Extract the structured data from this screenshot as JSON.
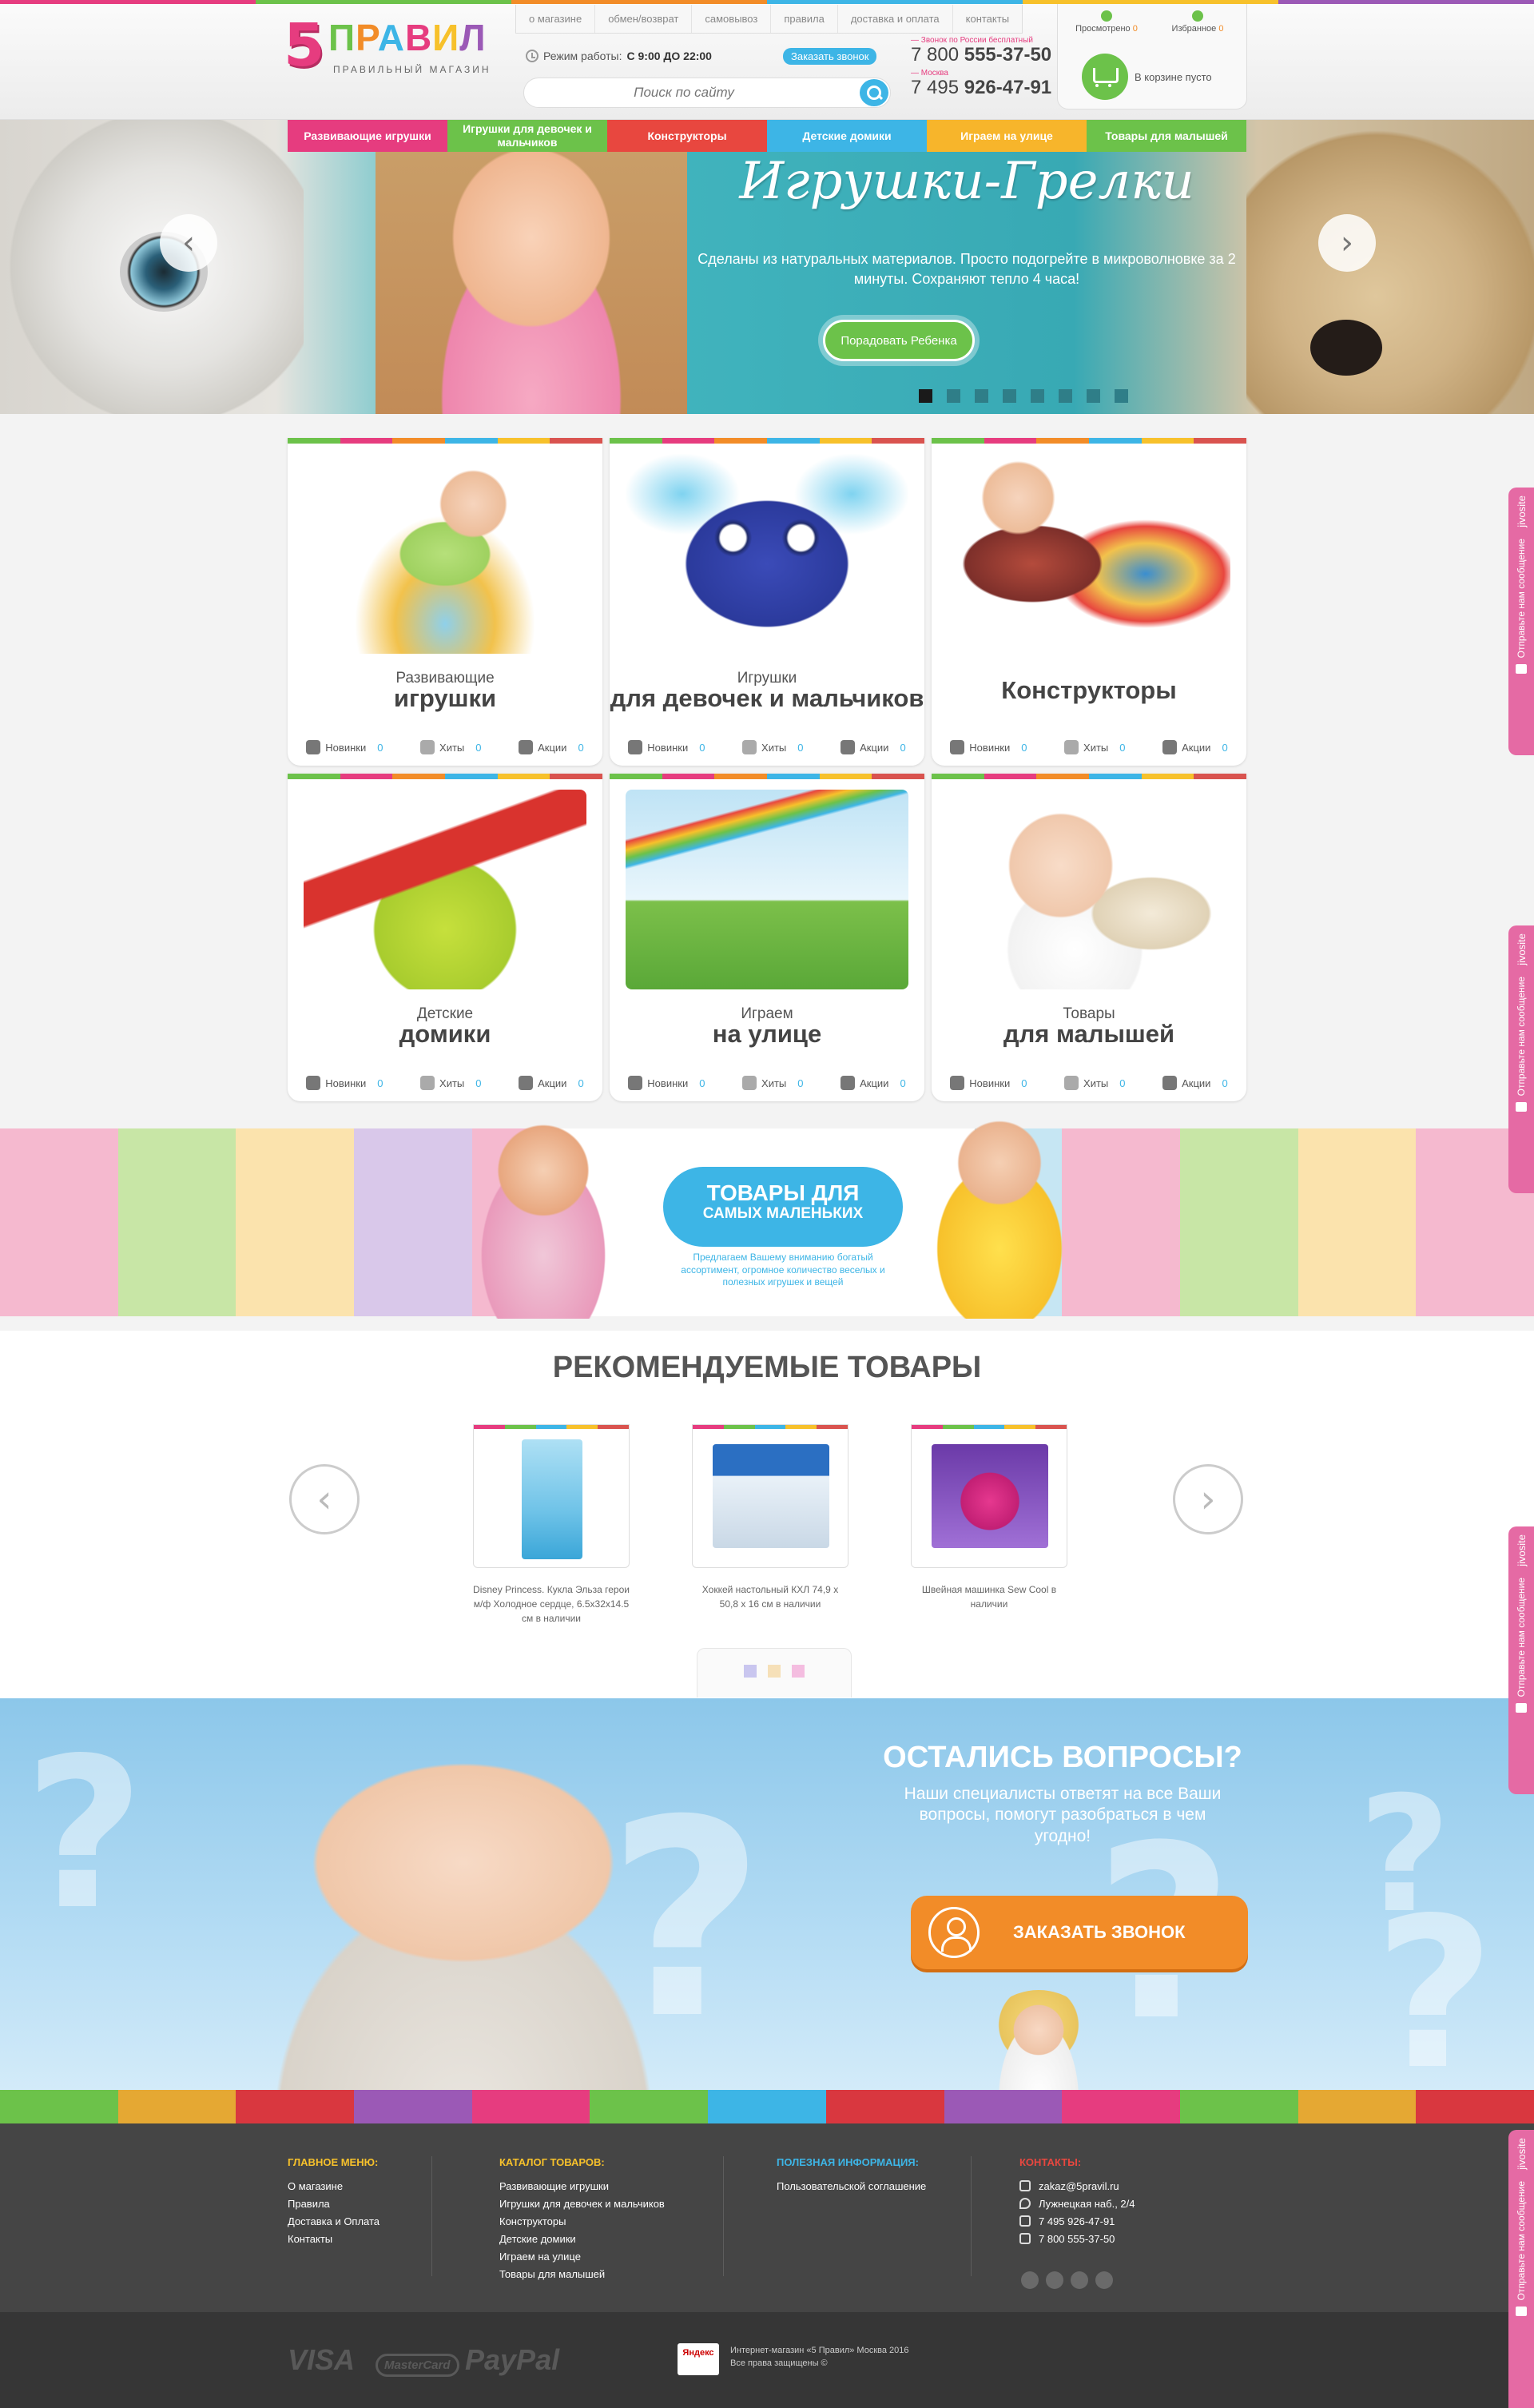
{
  "header": {
    "logo_number": "5",
    "logo_word": [
      "П",
      "Р",
      "А",
      "В",
      "И",
      "Л"
    ],
    "logo_tagline": "ПРАВИЛЬНЫЙ МАГАЗИН",
    "topnav": [
      "о магазине",
      "обмен/возврат",
      "самовывоз",
      "правила",
      "доставка и оплата",
      "контакты"
    ],
    "worktime_label": "Режим работы:",
    "worktime_value": "С 9:00 ДО 22:00",
    "callback_pill": "Заказать звонок",
    "search_placeholder": "Поиск по сайту",
    "phone1_note": "Звонок по России бесплатный",
    "phone1_prefix": "7 800",
    "phone1_number": "555-37-50",
    "phone2_note": "Москва",
    "phone2_prefix": "7 495",
    "phone2_number": "926-47-91",
    "viewed_label": "Просмотрено",
    "viewed_count": "0",
    "favorites_label": "Избранное",
    "favorites_count": "0",
    "cart_text": "В корзине пусто"
  },
  "categories_nav": [
    {
      "label": "Развивающие игрушки",
      "color": "#e63c7f"
    },
    {
      "label": "Игрушки для девочек и мальчиков",
      "color": "#6cc24a"
    },
    {
      "label": "Конструкторы",
      "color": "#e8473f"
    },
    {
      "label": "Детские домики",
      "color": "#3db5e6"
    },
    {
      "label": "Играем на улице",
      "color": "#f7b52b"
    },
    {
      "label": "Товары для малышей",
      "color": "#6cc24a"
    }
  ],
  "hero": {
    "title": "Игрушки-Грелки",
    "text": "Сделаны из натуральных материалов. Просто подогрейте в микроволновке за 2 минуты. Сохраняют тепло 4 часа!",
    "button": "Порадовать Ребенка",
    "slides_total": 8,
    "active_slide": 1
  },
  "category_cards": [
    {
      "sub": "Развивающие",
      "title": "игрушки",
      "new_label": "Новинки",
      "new": "0",
      "hits_label": "Хиты",
      "hits": "0",
      "sale_label": "Акции",
      "sale": "0"
    },
    {
      "sub": "Игрушки",
      "title": "для девочек и мальчиков",
      "new_label": "Новинки",
      "new": "0",
      "hits_label": "Хиты",
      "hits": "0",
      "sale_label": "Акции",
      "sale": "0"
    },
    {
      "sub": "",
      "title": "Конструкторы",
      "new_label": "Новинки",
      "new": "0",
      "hits_label": "Хиты",
      "hits": "0",
      "sale_label": "Акции",
      "sale": "0"
    },
    {
      "sub": "Детские",
      "title": "домики",
      "new_label": "Новинки",
      "new": "0",
      "hits_label": "Хиты",
      "hits": "0",
      "sale_label": "Акции",
      "sale": "0"
    },
    {
      "sub": "Играем",
      "title": "на улице",
      "new_label": "Новинки",
      "new": "0",
      "hits_label": "Хиты",
      "hits": "0",
      "sale_label": "Акции",
      "sale": "0"
    },
    {
      "sub": "Товары",
      "title": "для малышей",
      "new_label": "Новинки",
      "new": "0",
      "hits_label": "Хиты",
      "hits": "0",
      "sale_label": "Акции",
      "sale": "0"
    }
  ],
  "kids_banner": {
    "title": "ТОВАРЫ ДЛЯ",
    "title2": "САМЫХ МАЛЕНЬКИХ",
    "text": "Предлагаем Вашему вниманию богатый ассортимент, огромное количество веселых и полезных игрушек и вещей"
  },
  "recommended": {
    "title": "РЕКОМЕНДУЕМЫЕ ТОВАРЫ",
    "products": [
      {
        "name": "Disney Princess. Кукла Эльза герои м/ф Холодное сердце, 6.5х32х14.5 см в наличии"
      },
      {
        "name": "Хоккей настольный КХЛ 74,9 х 50,8 х 16 см в наличии"
      },
      {
        "name": "Швейная машинка Sew Cool в наличии"
      }
    ],
    "pager_colors": [
      "#c9c6ef",
      "#f6e0b8",
      "#f4bde0"
    ]
  },
  "questions": {
    "title": "ОСТАЛИСЬ ВОПРОСЫ?",
    "text": "Наши специалисты ответят на все Ваши вопросы, помогут разобраться в чем угодно!",
    "button": "ЗАКАЗАТЬ ЗВОНОК"
  },
  "footer": {
    "main_menu_title": "ГЛАВНОЕ МЕНЮ:",
    "main_menu": [
      "О магазине",
      "Правила",
      "Доставка и Оплата",
      "Контакты"
    ],
    "catalog_title": "КАТАЛОГ ТОВАРОВ:",
    "catalog": [
      "Развивающие игрушки",
      "Игрушки для девочек и мальчиков",
      "Конструкторы",
      "Детские домики",
      "Играем на улице",
      "Товары для малышей"
    ],
    "info_title": "ПОЛЕЗНАЯ ИНФОРМАЦИЯ:",
    "info": [
      "Пользовательской соглашение"
    ],
    "contacts_title": "КОНТАКТЫ:",
    "email": "zakaz@5pravil.ru",
    "address": "Лужнецкая наб., 2/4",
    "phone1": "7 495 926-47-91",
    "phone2": "7 800 555-37-50",
    "social_icons": [
      "vk-icon",
      "twitter-icon",
      "facebook-icon",
      "odnoklassniki-icon"
    ],
    "colors": {
      "main": "#f7c12b",
      "catalog": "#f7c12b",
      "info": "#3db5e6",
      "contacts": "#e8473f"
    }
  },
  "bottom": {
    "pay_methods": [
      "VISA",
      "MasterCard",
      "PayPal"
    ],
    "yandex": "Яндекс",
    "copyright1": "Интернет-магазин «5 Правил» Москва 2016",
    "copyright2": "Все права защищены ©"
  },
  "side_widget": {
    "brand": "jivosite",
    "message": "Отправьте нам сообщение"
  }
}
